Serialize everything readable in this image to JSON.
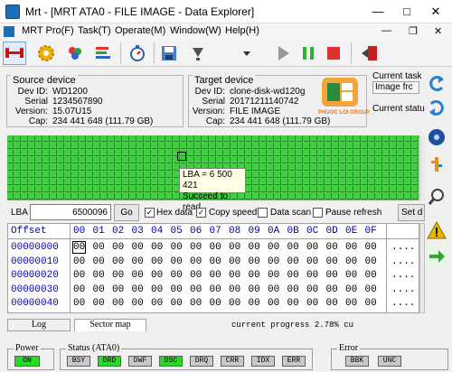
{
  "window": {
    "title": "Mrt - [MRT ATA0 - FILE IMAGE - Data Explorer]"
  },
  "menu": [
    {
      "label": "MRT Pro(F)"
    },
    {
      "label": "Task(T)"
    },
    {
      "label": "Operate(M)"
    },
    {
      "label": "Window(W)"
    },
    {
      "label": "Help(H)"
    }
  ],
  "source": {
    "title": "Source device",
    "dev_id_label": "Dev ID:",
    "dev_id": "WD1200",
    "serial_label": "Serial",
    "serial": "1234567890",
    "version_label": "Version:",
    "version": "15.07U15",
    "cap_label": "Cap:",
    "cap": "234 441 648 (111.79 GB)"
  },
  "target": {
    "title": "Target device",
    "dev_id_label": "Dev ID:",
    "dev_id": "clone-disk-wd120g",
    "serial_label": "Serial",
    "serial": "20171211140742",
    "version_label": "Version:",
    "version": "FILE IMAGE",
    "cap_label": "Cap:",
    "cap": "234 441 648 (111.79 GB)"
  },
  "current_task": {
    "label": "Current task",
    "value": "Image frc"
  },
  "current_status": {
    "label": "Current statu"
  },
  "logo": {
    "text": "PHUOC LOI GROUP"
  },
  "tooltip": {
    "line1": "LBA = 6 500 421",
    "line2": "Succeed to read"
  },
  "controls": {
    "lba_label": "LBA",
    "lba_value": "6500096",
    "go_label": "Go",
    "hex_data": "Hex data",
    "copy_speed": "Copy speed",
    "data_scan": "Data scan",
    "pause_refresh": "Pause refresh",
    "set_label": "Set d"
  },
  "hex": {
    "offset_label": "Offset",
    "columns": [
      "00",
      "01",
      "02",
      "03",
      "04",
      "05",
      "06",
      "07",
      "08",
      "09",
      "0A",
      "0B",
      "0C",
      "0D",
      "0E",
      "0F"
    ],
    "rows": [
      "00000000",
      "00000010",
      "00000020",
      "00000030",
      "00000040"
    ],
    "byte": "00",
    "ascii": "...."
  },
  "tabs": {
    "log": "Log",
    "sector_map": "Sector map"
  },
  "progress_text": "current progress 2.78% cu",
  "status": {
    "power_title": "Power",
    "power_on": "ON",
    "status_title": "Status (ATA0)",
    "status_flags": [
      "BSY",
      "DRD",
      "DWF",
      "DSC",
      "DRQ",
      "CRR",
      "IDX",
      "ERR"
    ],
    "error_title": "Error",
    "error_flags": [
      "BBK",
      "UNC"
    ]
  },
  "colors": {
    "sector_ok": "#3fd13f",
    "flag_on": "#22dd22",
    "flag_off": "#c8c8c8",
    "hex_header": "#0000aa"
  },
  "icons": {
    "toolbar": [
      "connect-icon",
      "settings-gear-icon",
      "recycle-icon",
      "bars-icon",
      "stopwatch-icon",
      "save-icon",
      "down-arrow-icon",
      "play-icon",
      "pause-icon",
      "stop-icon",
      "exit-icon"
    ],
    "right": [
      "back-arrow-icon",
      "refresh-icon",
      "disk-icon",
      "usb-icon",
      "search-icon",
      "warning-icon",
      "forward-arrow-icon"
    ]
  }
}
